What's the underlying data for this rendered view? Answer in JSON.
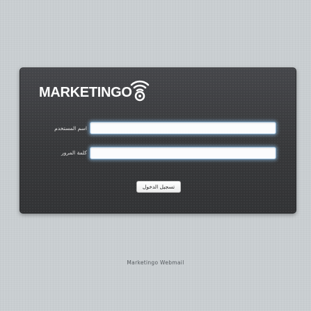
{
  "brand": {
    "logo_text": "MARKETINGO"
  },
  "login_form": {
    "username_label": "اسم المستخدم",
    "username_value": "",
    "password_label": "كلمة المرور",
    "password_value": "",
    "submit_label": "تسجيل الدخول"
  },
  "footer": {
    "text": "Marketingo Webmail"
  },
  "colors": {
    "page_background": "#c9ced1",
    "panel_background": "#3a3b3d",
    "input_glow": "#8fb6d6"
  }
}
